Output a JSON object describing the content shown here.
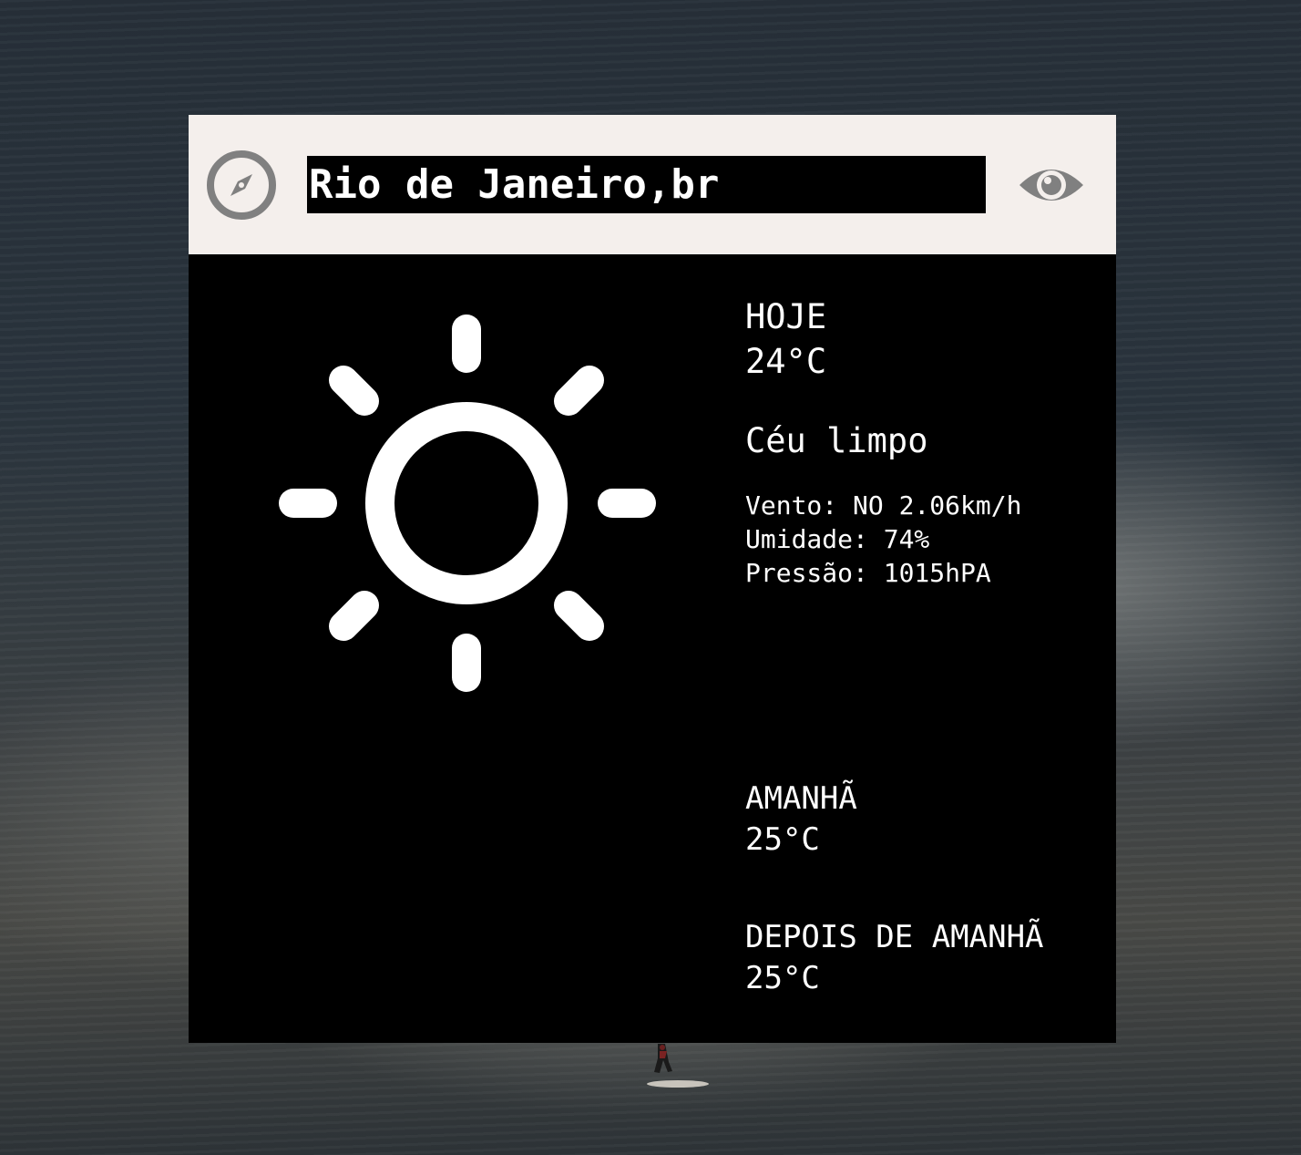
{
  "search": {
    "value": "Rio de Janeiro,br"
  },
  "icons": {
    "locate": "compass-icon",
    "toggle": "eye-icon",
    "weather": "sun-icon"
  },
  "colors": {
    "header_bg": "#f4efec",
    "panel_bg": "#000000",
    "icon_gray": "#808080",
    "text": "#ffffff"
  },
  "today": {
    "label": "HOJE",
    "temp": "24°C",
    "description": "Céu limpo",
    "wind": "Vento: NO 2.06km/h",
    "humidity": "Umidade: 74%",
    "pressure": "Pressão: 1015hPA"
  },
  "tomorrow": {
    "label": "AMANHÃ",
    "temp": "25°C"
  },
  "day_after": {
    "label": "DEPOIS DE AMANHÃ",
    "temp": "25°C"
  }
}
